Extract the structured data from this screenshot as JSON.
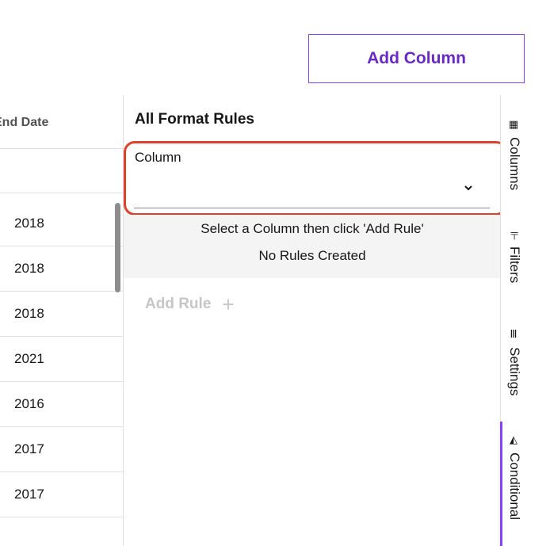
{
  "toolbar": {
    "add_column_label": "Add Column"
  },
  "table": {
    "header_label": "End Date",
    "rows": [
      "2018",
      "2018",
      "2018",
      "2021",
      "2016",
      "2017",
      "2017"
    ]
  },
  "format_panel": {
    "title": "All Format Rules",
    "column_label": "Column",
    "column_value": "",
    "info_line1": "Select a Column then click 'Add Rule'",
    "info_line2": "No Rules Created",
    "add_rule_label": "Add Rule",
    "add_rule_icon": "plus-icon"
  },
  "side_tabs": [
    {
      "label": "Columns",
      "icon": "columns-grid-icon",
      "active": false
    },
    {
      "label": "Filters",
      "icon": "filter-icon",
      "active": false
    },
    {
      "label": "Settings",
      "icon": "settings-bars-icon",
      "active": false
    },
    {
      "label": "Conditional",
      "icon": "paint-bucket-icon",
      "active": true
    }
  ],
  "colors": {
    "accent": "#8a3ffc",
    "accent_text": "#6929c4",
    "highlight": "#e0412a"
  }
}
